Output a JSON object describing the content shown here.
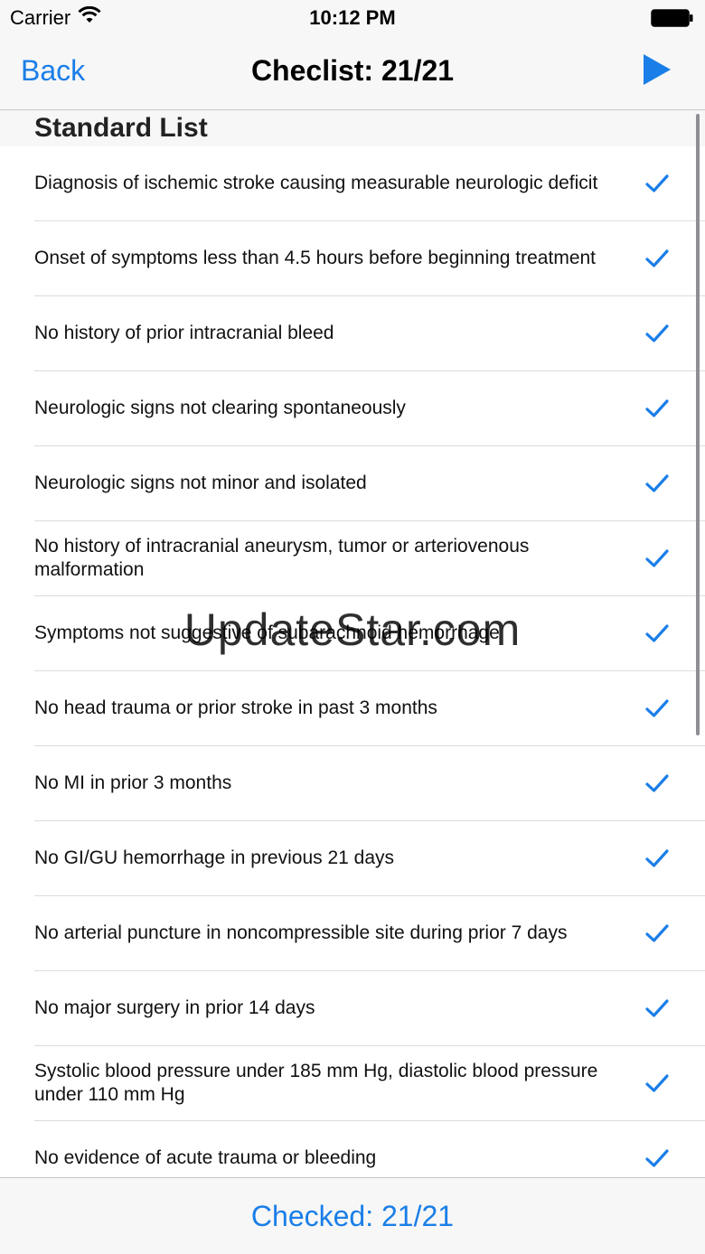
{
  "status_bar": {
    "carrier": "Carrier",
    "time": "10:12 PM"
  },
  "nav": {
    "back_label": "Back",
    "title": "Checlist: 21/21"
  },
  "section": {
    "title": "Standard List"
  },
  "items": [
    {
      "text": "Diagnosis of ischemic stroke causing measurable neurologic deficit",
      "checked": true
    },
    {
      "text": "Onset of symptoms less than 4.5 hours before beginning treatment",
      "checked": true
    },
    {
      "text": "No history of prior intracranial bleed",
      "checked": true
    },
    {
      "text": "Neurologic signs not clearing spontaneously",
      "checked": true
    },
    {
      "text": "Neurologic signs not minor and isolated",
      "checked": true
    },
    {
      "text": "No history of intracranial aneurysm, tumor or arteriovenous malformation",
      "checked": true
    },
    {
      "text": "Symptoms not suggestive of subarachnoid hemorrhage",
      "checked": true
    },
    {
      "text": "No head trauma or prior stroke in past 3 months",
      "checked": true
    },
    {
      "text": "No MI in prior 3 months",
      "checked": true
    },
    {
      "text": "No GI/GU hemorrhage in previous 21 days",
      "checked": true
    },
    {
      "text": "No arterial puncture in noncompressible site during prior 7 days",
      "checked": true
    },
    {
      "text": "No major surgery in prior 14 days",
      "checked": true
    },
    {
      "text": "Systolic blood pressure under 185 mm Hg, diastolic blood pressure under 110 mm Hg",
      "checked": true
    },
    {
      "text": "No evidence of acute trauma or bleeding",
      "checked": true
    }
  ],
  "watermark": "UpdateStar.com",
  "footer": {
    "checked_label": "Checked: 21/21"
  },
  "colors": {
    "accent": "#1a7ee8",
    "bar_background": "#f7f7f7",
    "separator": "#dcdcdf"
  },
  "icons": {
    "wifi": "wifi-icon",
    "battery": "battery-icon",
    "play": "play-icon",
    "check": "checkmark-icon"
  }
}
